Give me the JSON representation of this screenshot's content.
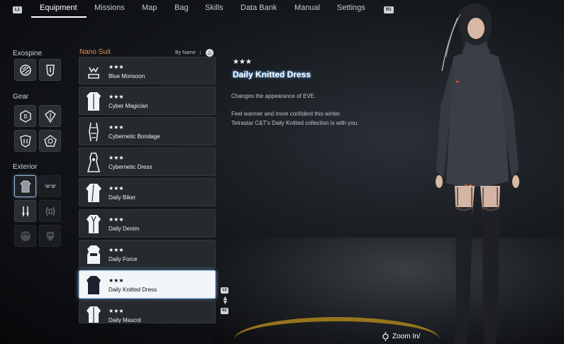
{
  "nav": {
    "hint_left": "L1",
    "hint_right": "R1",
    "tabs": [
      {
        "label": "Equipment",
        "active": true
      },
      {
        "label": "Missions",
        "active": false
      },
      {
        "label": "Map",
        "active": false
      },
      {
        "label": "Bag",
        "active": false
      },
      {
        "label": "Skills",
        "active": false
      },
      {
        "label": "Data Bank",
        "active": false
      },
      {
        "label": "Manual",
        "active": false
      },
      {
        "label": "Settings",
        "active": false
      }
    ]
  },
  "categories": {
    "exospine": {
      "label": "Exospine",
      "slots": [
        "exospine-icon",
        "exospine-alt-icon"
      ]
    },
    "gear": {
      "label": "Gear",
      "slots": [
        "gear-slot-1-icon",
        "gear-slot-2-icon",
        "gear-slot-3-icon",
        "gear-slot-4-icon"
      ]
    },
    "exterior": {
      "label": "Exterior",
      "slots": [
        "suit-icon",
        "glasses-icon",
        "earrings-icon",
        "hair-ornament-icon",
        "hairstyle-icon",
        "mask-icon"
      ]
    }
  },
  "list": {
    "title": "Nano Suit",
    "sort_label": "By Name",
    "sort_button": "△",
    "items": [
      {
        "stars": "★★★",
        "name": "Blue Monsoon",
        "selected": false
      },
      {
        "stars": "★★★",
        "name": "Cyber Magician",
        "selected": false
      },
      {
        "stars": "★★★",
        "name": "Cybernetic Bondage",
        "selected": false
      },
      {
        "stars": "★★★",
        "name": "Cybernetic Dress",
        "selected": false
      },
      {
        "stars": "★★★",
        "name": "Daily Biker",
        "selected": false
      },
      {
        "stars": "★★★",
        "name": "Daily Denim",
        "selected": false
      },
      {
        "stars": "★★★",
        "name": "Daily Force",
        "selected": false
      },
      {
        "stars": "★★★",
        "name": "Daily Knitted Dress",
        "selected": true
      },
      {
        "stars": "★★★",
        "name": "Daily Mascot",
        "selected": false
      }
    ],
    "scroll_up_hint": "L2",
    "scroll_down_hint": "R2"
  },
  "detail": {
    "stars": "★★★",
    "title": "Daily Knitted Dress",
    "line1": "Changes the appearance of EVE.",
    "line2": "Feel warmer and more confident this winter.",
    "line3": "Tetrastar C&T's Daily Knitted collection is with you."
  },
  "zoom": {
    "label": "Zoom In/"
  },
  "colors": {
    "accent": "#e8904f",
    "selected_glow": "#7fb0e0",
    "floor_stripe": "#b58a1c"
  }
}
